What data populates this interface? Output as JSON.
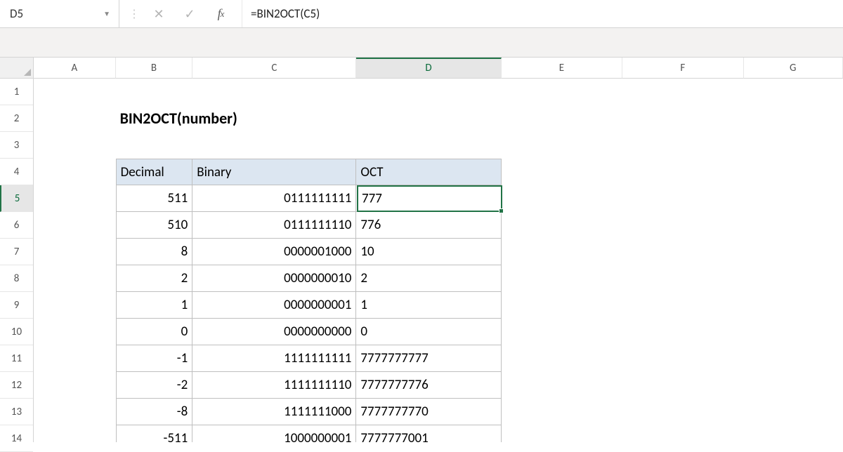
{
  "nameBox": "D5",
  "formula": "=BIN2OCT(C5)",
  "title": "BIN2OCT(number)",
  "columns": [
    "A",
    "B",
    "C",
    "D",
    "E",
    "F",
    "G"
  ],
  "rowLabels": [
    "1",
    "2",
    "3",
    "4",
    "5",
    "6",
    "7",
    "8",
    "9",
    "10",
    "11",
    "12",
    "13",
    "14"
  ],
  "headers": {
    "b": "Decimal",
    "c": "Binary",
    "d": "OCT"
  },
  "rows": [
    {
      "dec": "511",
      "bin": "0111111111",
      "oct": "777"
    },
    {
      "dec": "510",
      "bin": "0111111110",
      "oct": "776"
    },
    {
      "dec": "8",
      "bin": "0000001000",
      "oct": "10"
    },
    {
      "dec": "2",
      "bin": "0000000010",
      "oct": "2"
    },
    {
      "dec": "1",
      "bin": "0000000001",
      "oct": "1"
    },
    {
      "dec": "0",
      "bin": "0000000000",
      "oct": "0"
    },
    {
      "dec": "-1",
      "bin": "1111111111",
      "oct": "7777777777"
    },
    {
      "dec": "-2",
      "bin": "1111111110",
      "oct": "7777777776"
    },
    {
      "dec": "-8",
      "bin": "1111111000",
      "oct": "7777777770"
    },
    {
      "dec": "-511",
      "bin": "1000000001",
      "oct": "7777777001"
    }
  ],
  "activeCell": {
    "col": "D",
    "row": 5
  }
}
